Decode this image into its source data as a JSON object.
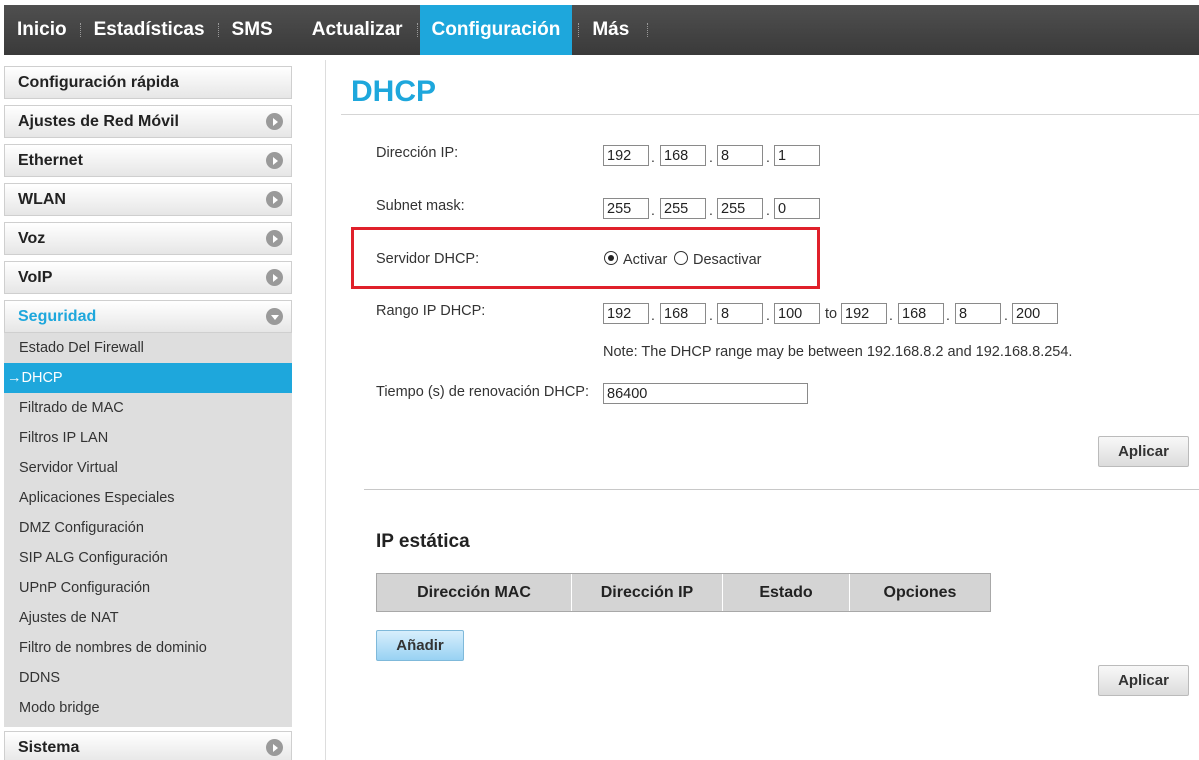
{
  "nav": {
    "tabs": [
      {
        "label": "Inicio"
      },
      {
        "label": "Estadísticas"
      },
      {
        "label": "SMS"
      },
      {
        "label": "Actualizar"
      },
      {
        "label": "Configuración"
      },
      {
        "label": "Más"
      }
    ],
    "active": "Configuración",
    "accent_color": "#1ea7dc"
  },
  "sidebar": {
    "sections": [
      {
        "label": "Configuración rápida"
      },
      {
        "label": "Ajustes de Red Móvil"
      },
      {
        "label": "Ethernet"
      },
      {
        "label": "WLAN"
      },
      {
        "label": "Voz"
      },
      {
        "label": "VoIP"
      },
      {
        "label": "Seguridad"
      },
      {
        "label": "Sistema"
      }
    ],
    "security_items": [
      {
        "label": "Estado Del Firewall"
      },
      {
        "label": "→DHCP"
      },
      {
        "label": "Filtrado de MAC"
      },
      {
        "label": "Filtros IP LAN"
      },
      {
        "label": "Servidor Virtual"
      },
      {
        "label": "Aplicaciones Especiales"
      },
      {
        "label": "DMZ Configuración"
      },
      {
        "label": "SIP ALG Configuración"
      },
      {
        "label": "UPnP Configuración"
      },
      {
        "label": "Ajustes de NAT"
      },
      {
        "label": "Filtro de nombres de dominio"
      },
      {
        "label": "DDNS"
      },
      {
        "label": "Modo bridge"
      }
    ]
  },
  "page": {
    "title": "DHCP",
    "ip_label": "Dirección IP:",
    "ip": [
      "192",
      "168",
      "8",
      "1"
    ],
    "mask_label": "Subnet mask:",
    "mask": [
      "255",
      "255",
      "255",
      "0"
    ],
    "dhcp_label": "Servidor DHCP:",
    "enable_label": "Activar",
    "disable_label": "Desactivar",
    "dhcp_enabled": true,
    "range_label": "Rango IP DHCP:",
    "range_start": [
      "192",
      "168",
      "8",
      "100"
    ],
    "range_to": "to",
    "range_end": [
      "192",
      "168",
      "8",
      "200"
    ],
    "note": "Note: The DHCP range may be between 192.168.8.2 and 192.168.8.254.",
    "lease_label": "Tiempo (s) de renovación DHCP:",
    "lease_value": "86400",
    "apply_label": "Aplicar",
    "dot": "."
  },
  "static_ip": {
    "title": "IP estática",
    "columns": [
      "Dirección MAC",
      "Dirección IP",
      "Estado",
      "Opciones"
    ],
    "add_label": "Añadir",
    "apply_label": "Aplicar"
  },
  "highlight_color": "#e0202a"
}
